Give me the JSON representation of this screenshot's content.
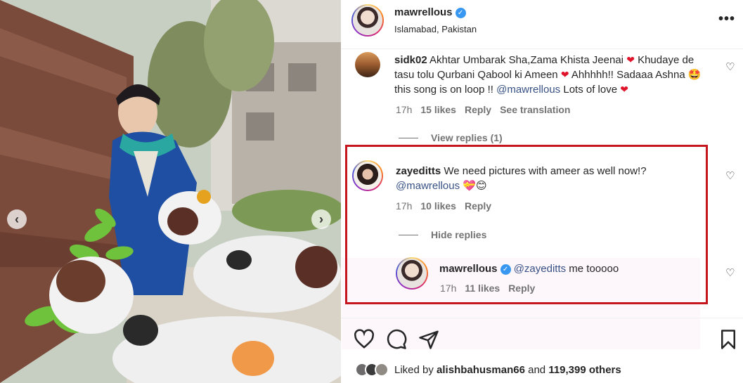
{
  "post": {
    "username": "mawrellous",
    "location": "Islamabad, Pakistan",
    "more_icon": "more-horizontal-icon"
  },
  "photo": {
    "prev_icon": "chevron-left-icon",
    "next_icon": "chevron-right-icon",
    "prev_glyph": "‹",
    "next_glyph": "›"
  },
  "comments": [
    {
      "username": "sidk02",
      "text_parts": [
        "Akhtar Umbarak Sha,Zama Khista Jeenai ",
        " Khudaye de tasu tolu Qurbani Qabool ki Ameen ",
        " Ahhhhh!! Sadaaa Ashna ",
        " this song is on loop !! ",
        "@mawrellous",
        " Lots of love "
      ],
      "time": "17h",
      "likes": "15 likes",
      "reply": "Reply",
      "translate": "See translation",
      "view_replies": "View replies (1)"
    },
    {
      "username": "zayeditts",
      "text_parts": [
        "We need pictures with ameer as well now!?",
        "@mawrellous"
      ],
      "time": "17h",
      "likes": "10 likes",
      "reply": "Reply",
      "hide_replies": "Hide replies",
      "replies": [
        {
          "username": "mawrellous",
          "mention": "@zayeditts",
          "text": " me tooooo",
          "time": "17h",
          "likes": "11 likes",
          "reply": "Reply"
        }
      ]
    }
  ],
  "likes": {
    "prefix": "Liked by ",
    "user": "alishbahusman66",
    "middle": " and ",
    "count": "119,399 others"
  },
  "colors": {
    "highlight": "#c4161c",
    "verified": "#3897f0",
    "mention": "#385185",
    "heart": "#e0142b"
  }
}
